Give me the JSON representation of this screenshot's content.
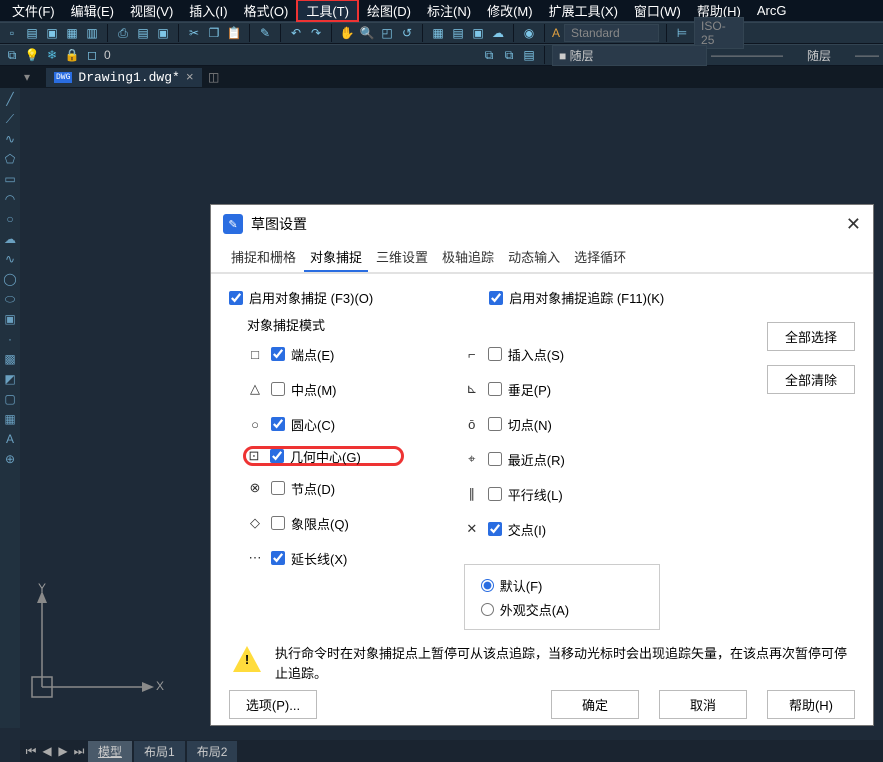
{
  "menu": {
    "file": "文件(F)",
    "edit": "编辑(E)",
    "view": "视图(V)",
    "insert": "插入(I)",
    "format": "格式(O)",
    "tools": "工具(T)",
    "draw": "绘图(D)",
    "annotate": "标注(N)",
    "modify": "修改(M)",
    "ext": "扩展工具(X)",
    "window": "窗口(W)",
    "help": "帮助(H)",
    "arc": "ArcG"
  },
  "toolbar": {
    "style_label": "Standard",
    "dim_label": "ISO-25",
    "layer_label": "随层",
    "layer_right": "随层",
    "layer_num": "0",
    "a_label": "A"
  },
  "fileTab": {
    "name": "Drawing1.dwg*",
    "close": "×"
  },
  "bottom": {
    "model": "模型",
    "layout1": "布局1",
    "layout2": "布局2"
  },
  "ucs": {
    "x": "X",
    "y": "Y"
  },
  "dialog": {
    "title": "草图设置",
    "tabs": {
      "snapGrid": "捕捉和栅格",
      "osnap": "对象捕捉",
      "threeD": "三维设置",
      "polar": "极轴追踪",
      "dyn": "动态输入",
      "cycle": "选择循环"
    },
    "enableOsnap": "启用对象捕捉 (F3)(O)",
    "enableTrack": "启用对象捕捉追踪 (F11)(K)",
    "modeLabel": "对象捕捉模式",
    "left": {
      "endpoint": "端点(E)",
      "midpoint": "中点(M)",
      "center": "圆心(C)",
      "geoCenter": "几何中心(G)",
      "node": "节点(D)",
      "quadrant": "象限点(Q)",
      "extension": "延长线(X)"
    },
    "right": {
      "insert": "插入点(S)",
      "perp": "垂足(P)",
      "tangent": "切点(N)",
      "nearest": "最近点(R)",
      "parallel": "平行线(L)",
      "intersection": "交点(I)"
    },
    "radio": {
      "default": "默认(F)",
      "apparent": "外观交点(A)"
    },
    "selectAll": "全部选择",
    "clearAll": "全部清除",
    "hint": "执行命令时在对象捕捉点上暂停可从该点追踪，当移动光标时会出现追踪矢量，在该点再次暂停可停止追踪。",
    "options": "选项(P)...",
    "ok": "确定",
    "cancel": "取消",
    "help": "帮助(H)"
  }
}
